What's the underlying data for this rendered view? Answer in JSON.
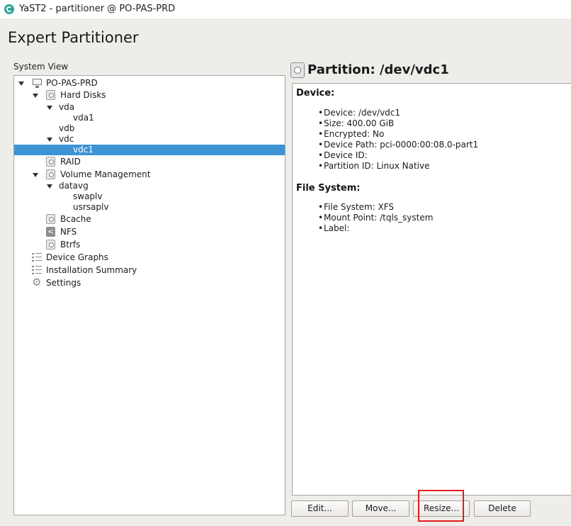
{
  "window": {
    "title": "YaST2 - partitioner @ PO-PAS-PRD"
  },
  "page": {
    "title": "Expert Partitioner"
  },
  "system_view": {
    "label": "System View",
    "tree": [
      {
        "label": "PO-PAS-PRD",
        "expanded": true,
        "icon": "computer-icon"
      },
      {
        "label": "Hard Disks",
        "expanded": true,
        "icon": "disk-icon"
      },
      {
        "label": "vda",
        "expanded": true
      },
      {
        "label": "vda1"
      },
      {
        "label": "vdb"
      },
      {
        "label": "vdc",
        "expanded": true
      },
      {
        "label": "vdc1",
        "selected": true
      },
      {
        "label": "RAID",
        "icon": "raid-icon"
      },
      {
        "label": "Volume Management",
        "expanded": true,
        "icon": "volume-icon"
      },
      {
        "label": "datavg",
        "expanded": true
      },
      {
        "label": "swaplv"
      },
      {
        "label": "usrsaplv"
      },
      {
        "label": "Bcache",
        "icon": "bcache-icon"
      },
      {
        "label": "NFS",
        "icon": "share-icon"
      },
      {
        "label": "Btrfs",
        "icon": "btrfs-icon"
      },
      {
        "label": "Device Graphs",
        "icon": "graph-list-icon"
      },
      {
        "label": "Installation Summary",
        "icon": "summary-list-icon"
      },
      {
        "label": "Settings",
        "icon": "gear-icon"
      }
    ]
  },
  "detail": {
    "title": "Partition: /dev/vdc1",
    "device_section": {
      "title": "Device:",
      "items": [
        "Device: /dev/vdc1",
        "Size: 400.00 GiB",
        "Encrypted: No",
        "Device Path: pci-0000:00:08.0-part1",
        "Device ID:",
        "Partition ID: Linux Native"
      ]
    },
    "fs_section": {
      "title": "File System:",
      "items": [
        "File System: XFS",
        "Mount Point: /tqls_system",
        "Label:"
      ]
    }
  },
  "buttons": {
    "edit": "Edit...",
    "move": "Move...",
    "resize": "Resize...",
    "delete": "Delete"
  },
  "colors": {
    "selection": "#3f93d5",
    "annotation_box": "#e31b1b",
    "app_icon": "#2ba59a"
  }
}
